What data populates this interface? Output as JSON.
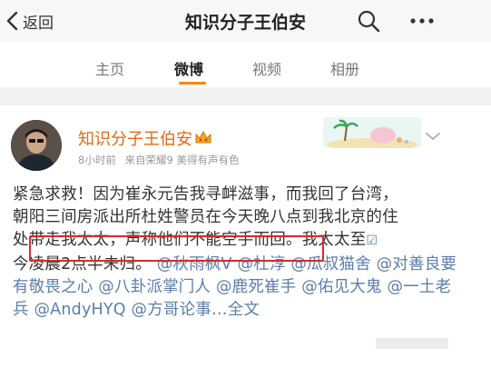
{
  "nav": {
    "back_label": "返回",
    "title": "知识分子王伯安"
  },
  "tabs": [
    {
      "label": "主页"
    },
    {
      "label": "微博"
    },
    {
      "label": "视频"
    },
    {
      "label": "相册"
    }
  ],
  "post": {
    "author": "知识分子王伯安",
    "time": "8小时前",
    "source": "来自荣耀9 美得有声有色",
    "body": {
      "line1": "紧急求救！因为崔永元告我寻衅滋事，而我回了台湾，",
      "line2": "朝阳三间房派出所杜姓警员在今天晚八点到我北京的住",
      "line3_start": "处",
      "line3_highlight": "带走我太太，声称他们不能空手而回",
      "line3_end": "。我太太至",
      "line4": "今凌晨2点半未归。",
      "mentions": [
        "@秋雨枫V",
        "@杜淳",
        "@瓜叔猫舍",
        "@对善良要有敬畏之心",
        "@八卦派掌门人",
        "@鹿死崔手",
        "@佑见大鬼",
        "@一土老兵",
        "@AndyHYQ",
        "@方哥论事"
      ],
      "more": "…全文"
    }
  },
  "colors": {
    "accent": "#ff8200",
    "author": "#e56a12",
    "link": "#5c7ea9",
    "highlight_border": "#d62b2b"
  }
}
